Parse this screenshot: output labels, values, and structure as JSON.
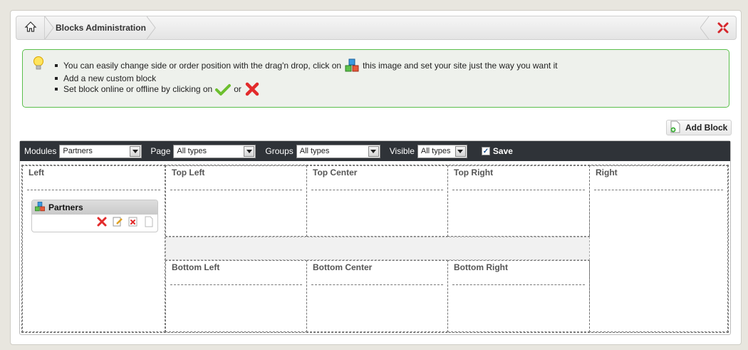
{
  "header": {
    "home_icon": "home-icon",
    "title": "Blocks Administration",
    "close_icon": "close-icon"
  },
  "info": {
    "icon": "lightbulb-icon",
    "line1_before": "You can easily change side or order position with the drag'n drop, click on",
    "line1_after": "this image and set your site just the way you want it",
    "line2": "Add a new custom block",
    "line3_before": "Set block online or offline by clicking on",
    "line3_or": "or",
    "accent": "#5bbf4c"
  },
  "add_block": {
    "label": "Add Block"
  },
  "filters": {
    "modules_label": "Modules",
    "modules_value": "Partners",
    "page_label": "Page",
    "page_value": "All types",
    "groups_label": "Groups",
    "groups_value": "All types",
    "visible_label": "Visible",
    "visible_value": "All types",
    "save_label": "Save"
  },
  "zones": {
    "left": "Left",
    "top_left": "Top Left",
    "top_center": "Top Center",
    "top_right": "Top Right",
    "right": "Right",
    "bottom_left": "Bottom Left",
    "bottom_center": "Bottom Center",
    "bottom_right": "Bottom Right"
  },
  "widget": {
    "name": "Partners",
    "tools": [
      "delete-icon",
      "edit-icon",
      "remove-icon",
      "page-icon"
    ]
  }
}
